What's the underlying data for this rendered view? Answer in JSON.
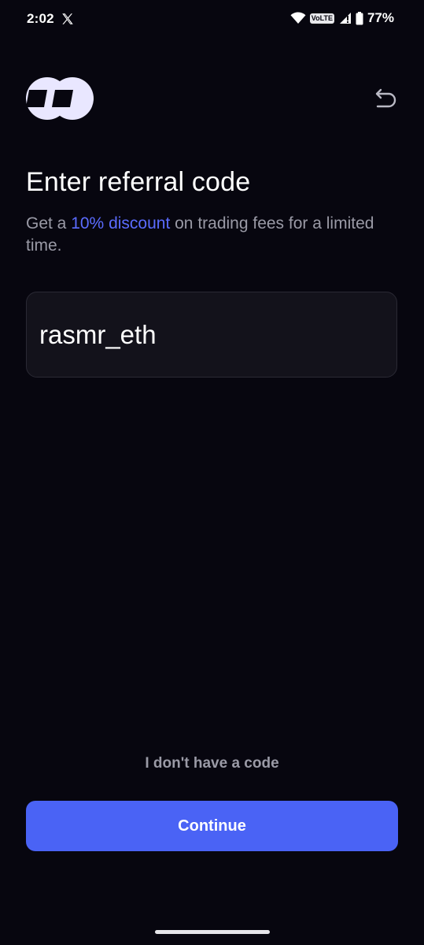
{
  "status_bar": {
    "time": "2:02",
    "volte": "VoLTE",
    "battery": "77%",
    "icons": [
      "x-logo-icon",
      "wifi-icon",
      "signal-icon",
      "battery-icon"
    ]
  },
  "header": {
    "logo_icon": "brand-logo-icon",
    "back_icon": "undo-arrow-icon"
  },
  "main": {
    "title": "Enter referral code",
    "subtitle_prefix": "Get a ",
    "subtitle_highlight": "10% discount",
    "subtitle_suffix": " on trading fees for a limited time.",
    "referral_input": {
      "value": "rasmr_eth",
      "placeholder": ""
    }
  },
  "footer": {
    "no_code_label": "I don't have a code",
    "continue_label": "Continue"
  },
  "colors": {
    "background": "#07060f",
    "accent": "#4a63f5",
    "highlight_text": "#5b6cff",
    "muted_text": "#9a9aa6",
    "input_bg": "#13121b"
  }
}
